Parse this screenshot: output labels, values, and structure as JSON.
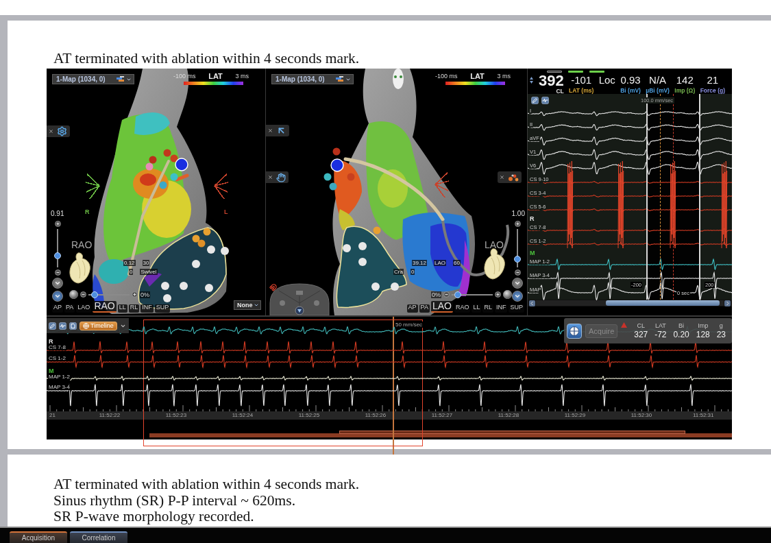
{
  "top_slide": {
    "caption": "AT terminated with ablation within 4 seconds mark."
  },
  "map_views": [
    {
      "map_selector": "1-Map (1034, 0)",
      "lat_scale": {
        "min": "-100 ms",
        "title": "LAT",
        "max": "3 ms"
      },
      "tools": [
        {
          "kind": "gear"
        }
      ],
      "orientation_marks": [
        {
          "label": "R",
          "color": "#6cbf45"
        },
        {
          "label": "L",
          "color": "#c8432c"
        }
      ],
      "view_info": [
        [
          "0.12",
          "30"
        ],
        [
          "0",
          "Swivel"
        ]
      ],
      "zoom": {
        "reading": "0.91",
        "level": 0.3
      },
      "view_name": "RAO",
      "opacity": {
        "reading": "0%",
        "level": 0.15
      },
      "views": [
        {
          "label": "AP",
          "selected": false
        },
        {
          "label": "PA",
          "selected": false
        },
        {
          "label": "LAO",
          "selected": false
        },
        {
          "label": "RAO",
          "selected": true
        },
        {
          "label": "LL",
          "selected": false
        },
        {
          "label": "RL",
          "selected": false
        },
        {
          "label": "INF",
          "selected": false
        },
        {
          "label": "SUP",
          "selected": false
        }
      ],
      "display_dropdown": "None"
    },
    {
      "map_selector": "1-Map (1034, 0)",
      "lat_scale": {
        "min": "-100 ms",
        "title": "LAT",
        "max": "3 ms"
      },
      "tools": [
        {
          "kind": "pointer"
        },
        {
          "kind": "hand"
        },
        {
          "kind": "dots"
        }
      ],
      "orientation_marks": [
        {
          "color": "#c8432c"
        }
      ],
      "view_info": [
        [
          "39.12",
          "LAO",
          "60"
        ],
        [
          "Cra",
          "0"
        ]
      ],
      "zoom": {
        "reading": "1.00",
        "level": 0.22
      },
      "view_name": "LAO",
      "opacity": {
        "reading": "0%",
        "level": 0.15
      },
      "views": [
        {
          "label": "AP",
          "selected": false
        },
        {
          "label": "PA",
          "selected": false
        },
        {
          "label": "LAO",
          "selected": true
        },
        {
          "label": "RAO",
          "selected": false
        },
        {
          "label": "LL",
          "selected": false
        },
        {
          "label": "RL",
          "selected": false
        },
        {
          "label": "INF",
          "selected": false
        },
        {
          "label": "SUP",
          "selected": false
        }
      ],
      "navigator": true
    }
  ],
  "signal_panel": {
    "indicators": [
      {
        "on": false
      },
      {
        "on": true
      },
      {
        "on": true
      }
    ],
    "readouts": [
      {
        "value": "392",
        "label": "CL",
        "color": "#e0e0e0"
      },
      {
        "value": "-101",
        "label": "LAT (ms)",
        "color": "#d8a838"
      },
      {
        "value": "Loc"
      },
      {
        "value": "0.93",
        "label": "Bi (mV)",
        "color": "#4ea0e0"
      },
      {
        "value": "N/A",
        "label": "µBi (mV)",
        "color": "#4ea0e0"
      },
      {
        "value": "142",
        "label": "Imp (Ω)",
        "color": "#78b850"
      },
      {
        "value": "21",
        "label": "Force (g)",
        "color": "#8a90e0"
      }
    ],
    "sweep_speed": "100.0 mm/sec",
    "channels": [
      {
        "kind": "surface",
        "label": "I",
        "color": "#e8e8e8"
      },
      {
        "kind": "surface",
        "label": "II",
        "color": "#e8e8e8"
      },
      {
        "kind": "surface",
        "label": "aVF",
        "color": "#e8e8e8"
      },
      {
        "kind": "surface",
        "label": "V1",
        "color": "#e8e8e8"
      },
      {
        "kind": "surface",
        "label": "V6",
        "color": "#e8e8e8"
      },
      {
        "kind": "cs",
        "label": "CS 9-10",
        "color": "#d23a22"
      },
      {
        "kind": "cs",
        "label": "CS 3-4",
        "color": "#d23a22"
      },
      {
        "kind": "cs",
        "label": "CS 5-6",
        "color": "#d23a22"
      },
      {
        "kind": "group",
        "label": "R",
        "color": "#e6e6e6"
      },
      {
        "kind": "cs",
        "label": "CS 7-8",
        "color": "#d23a22"
      },
      {
        "kind": "cs",
        "label": "CS 1-2",
        "color": "#d23a22"
      },
      {
        "kind": "group",
        "label": "M",
        "color": "#4cc23c"
      },
      {
        "kind": "map",
        "label": "MAP 1-2",
        "color": "#40c4c8"
      },
      {
        "kind": "map",
        "label": "MAP 3-4",
        "color": "#e6e6e6"
      },
      {
        "kind": "map",
        "label": "MAP",
        "color": "#e6e6e6"
      }
    ],
    "axis_labels": [
      "-200",
      "0 sec",
      "200"
    ]
  },
  "timeline": {
    "tool_button": "Timeline",
    "sweep_speed": "50 mm/sec",
    "channels": [
      {
        "kind": "surface",
        "color": "#40b8b8"
      },
      {
        "kind": "group",
        "label": "R",
        "color": "#e6e6e6"
      },
      {
        "kind": "cs",
        "label": "CS 7-8",
        "color": "#d23a22"
      },
      {
        "kind": "cs",
        "label": "CS 1-2",
        "color": "#d23a22"
      },
      {
        "kind": "group",
        "label": "M",
        "color": "#4cc23c"
      },
      {
        "kind": "map",
        "label": "MAP 1-2",
        "color": "#eeeed8"
      },
      {
        "kind": "map",
        "label": "MAP 3-4",
        "color": "#e6e6e6"
      }
    ],
    "times": [
      "21",
      "11:52:22",
      "11:52:23",
      "11:52:24",
      "11:52:25",
      "11:52:26",
      "11:52:27",
      "11:52:28",
      "11:52:29",
      "11:52:30",
      "11:52:31"
    ],
    "acquire_panel": {
      "button": {
        "label": "Acquire",
        "disabled": true
      },
      "warning": true,
      "metrics": [
        {
          "label": "CL",
          "value": "327"
        },
        {
          "label": "LAT",
          "value": "-72"
        },
        {
          "label": "Bi",
          "value": "0.20"
        },
        {
          "label": "Imp",
          "value": "128"
        },
        {
          "label": "g",
          "value": "23"
        }
      ]
    }
  },
  "bottom_slide": {
    "lines": [
      "AT terminated with ablation within 4 seconds mark.",
      "Sinus rhythm (SR) P-P interval ~ 620ms.",
      "SR P-wave morphology recorded."
    ]
  },
  "tabs": [
    {
      "label": "Acquisition",
      "selected": true
    },
    {
      "label": "Correlation",
      "selected": false
    }
  ]
}
